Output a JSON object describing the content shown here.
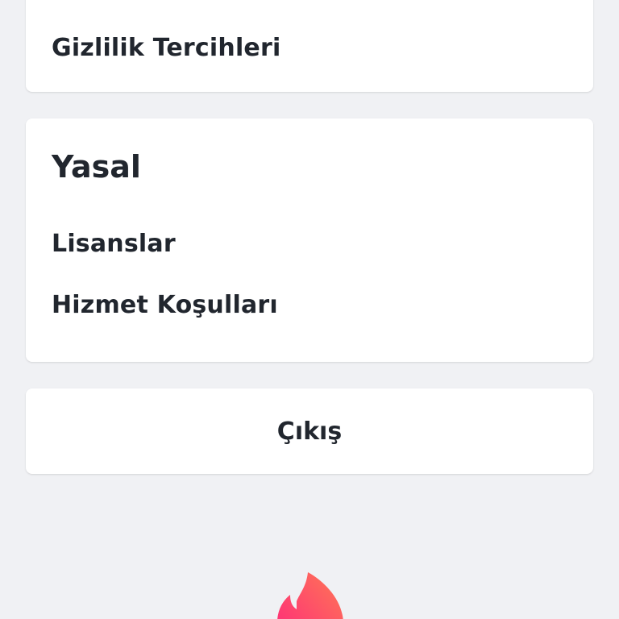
{
  "privacy": {
    "label": "Gizlilik Tercihleri"
  },
  "legal": {
    "title": "Yasal",
    "items": [
      {
        "label": "Lisanslar"
      },
      {
        "label": "Hizmet Koşulları"
      }
    ]
  },
  "logout": {
    "label": "Çıkış"
  },
  "branding": {
    "logo_icon": "flame-icon",
    "gradient_start": "#fd267d",
    "gradient_end": "#ff7854"
  }
}
